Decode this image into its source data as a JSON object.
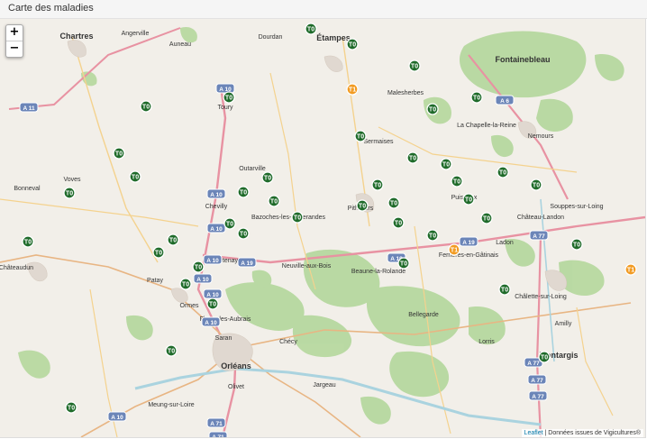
{
  "page": {
    "title": "Carte des maladies"
  },
  "map": {
    "zoom_in": "+",
    "zoom_out": "−",
    "attribution_link": "Leaflet",
    "attribution_sep": " | ",
    "attribution_text": "Données issues de Vigicultures®",
    "colors": {
      "green_marker": "#1f6b2a",
      "orange_marker": "#f29b22",
      "forest": "#b7d8a0",
      "background": "#f2efe9"
    },
    "markers": [
      {
        "label": "T0",
        "level": "green"
      },
      {
        "label": "T0",
        "level": "green"
      },
      {
        "label": "T0",
        "level": "green"
      },
      {
        "label": "T0",
        "level": "green"
      },
      {
        "label": "T0",
        "level": "green"
      },
      {
        "label": "T0",
        "level": "green"
      },
      {
        "label": "T0",
        "level": "green"
      },
      {
        "label": "T0",
        "level": "green"
      },
      {
        "label": "T0",
        "level": "green"
      },
      {
        "label": "T0",
        "level": "green"
      },
      {
        "label": "T0",
        "level": "green"
      },
      {
        "label": "T0",
        "level": "green"
      },
      {
        "label": "T0",
        "level": "green"
      },
      {
        "label": "T0",
        "level": "green"
      },
      {
        "label": "T0",
        "level": "green"
      },
      {
        "label": "T0",
        "level": "green"
      },
      {
        "label": "T0",
        "level": "green"
      },
      {
        "label": "T0",
        "level": "green"
      },
      {
        "label": "T0",
        "level": "green"
      },
      {
        "label": "T0",
        "level": "green"
      },
      {
        "label": "T0",
        "level": "green"
      },
      {
        "label": "T0",
        "level": "green"
      },
      {
        "label": "T0",
        "level": "green"
      },
      {
        "label": "T0",
        "level": "green"
      },
      {
        "label": "T0",
        "level": "green"
      },
      {
        "label": "T0",
        "level": "green"
      },
      {
        "label": "T0",
        "level": "green"
      },
      {
        "label": "T0",
        "level": "green"
      },
      {
        "label": "T0",
        "level": "green"
      },
      {
        "label": "T0",
        "level": "green"
      },
      {
        "label": "T0",
        "level": "green"
      },
      {
        "label": "T0",
        "level": "green"
      },
      {
        "label": "T0",
        "level": "green"
      },
      {
        "label": "T0",
        "level": "green"
      },
      {
        "label": "T0",
        "level": "green"
      },
      {
        "label": "T0",
        "level": "green"
      },
      {
        "label": "T0",
        "level": "green"
      },
      {
        "label": "T0",
        "level": "green"
      },
      {
        "label": "T0",
        "level": "green"
      },
      {
        "label": "T0",
        "level": "green"
      },
      {
        "label": "T0",
        "level": "green"
      },
      {
        "label": "T1",
        "level": "orange"
      },
      {
        "label": "T1",
        "level": "orange"
      },
      {
        "label": "T1",
        "level": "orange"
      }
    ],
    "place_labels": [
      "Chartres",
      "Étampes",
      "Fontainebleau",
      "Nemours",
      "Pithiviers",
      "Malesherbes",
      "Orléans",
      "Saran",
      "Olivet",
      "Châteaudun",
      "Artenay",
      "Patay",
      "Neuville-aux-Bois",
      "Beaune-la-Rolande",
      "Bellegarde",
      "Montargis",
      "Châlette-sur-Loing",
      "Amilly",
      "Toury",
      "Angerville",
      "Ferrières-en-Gâtinais",
      "Puiseaux",
      "Voves",
      "Bonneval",
      "Lorris",
      "Jargeau",
      "Meung-sur-Loire",
      "Bazoches-les-Gallerandes",
      "Outarville",
      "Sermaises",
      "Auneau",
      "Dourdan",
      "Ormes",
      "Fleury-les-Aubrais",
      "Chécy",
      "La Chapelle-la-Reine",
      "Château-Landon",
      "Souppes-sur-Loing",
      "Ladon",
      "Chevilly"
    ],
    "road_labels": [
      "A 10",
      "A 10",
      "A 10",
      "A 10",
      "A 10",
      "A 10",
      "A 10",
      "A 10",
      "A 19",
      "A 19",
      "A 19",
      "A 77",
      "A 77",
      "A 77",
      "A 77",
      "A 71",
      "A 71",
      "A 11",
      "A 6"
    ]
  }
}
